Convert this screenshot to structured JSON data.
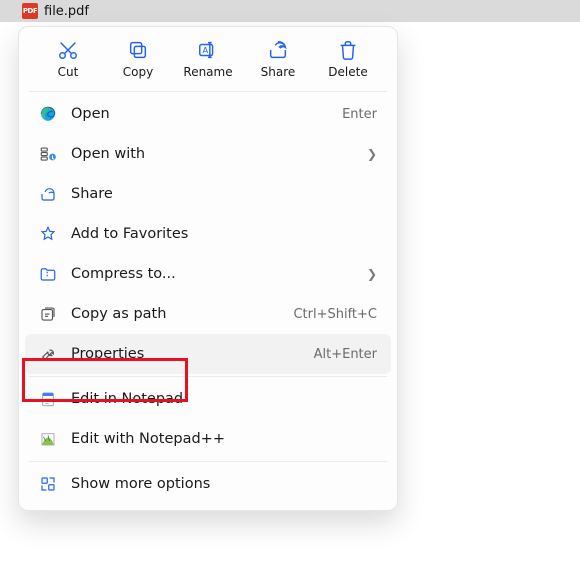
{
  "file": {
    "name": "file.pdf",
    "icon_label": "PDF"
  },
  "toolbar": {
    "cut": {
      "label": "Cut"
    },
    "copy": {
      "label": "Copy"
    },
    "rename": {
      "label": "Rename"
    },
    "share": {
      "label": "Share"
    },
    "delete": {
      "label": "Delete"
    }
  },
  "menu": {
    "open": {
      "label": "Open",
      "accel": "Enter"
    },
    "openwith": {
      "label": "Open with"
    },
    "share": {
      "label": "Share"
    },
    "favorites": {
      "label": "Add to Favorites"
    },
    "compress": {
      "label": "Compress to..."
    },
    "copypath": {
      "label": "Copy as path",
      "accel": "Ctrl+Shift+C"
    },
    "properties": {
      "label": "Properties",
      "accel": "Alt+Enter"
    },
    "notepad": {
      "label": "Edit in Notepad"
    },
    "notepadpp": {
      "label": "Edit with Notepad++"
    },
    "showmore": {
      "label": "Show more options"
    }
  }
}
